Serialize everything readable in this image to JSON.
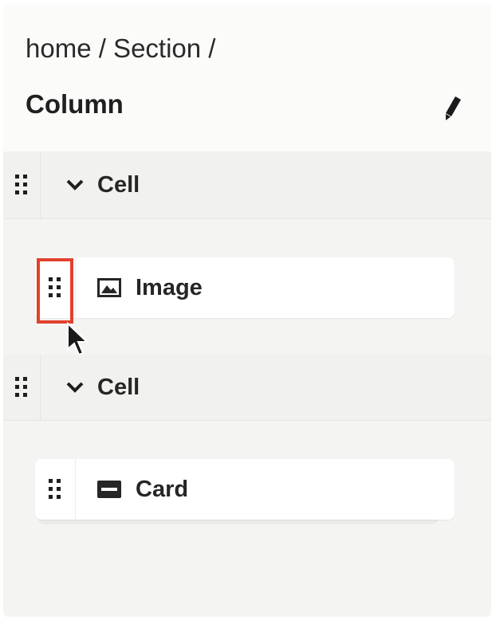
{
  "header": {
    "breadcrumb": "home / Section /",
    "title": "Column",
    "edit_icon": "pencil-icon"
  },
  "tree": {
    "cells": [
      {
        "label": "Cell",
        "expanded": true,
        "children": [
          {
            "label": "Image",
            "icon": "image-icon"
          }
        ]
      },
      {
        "label": "Cell",
        "expanded": true,
        "children": [
          {
            "label": "Card",
            "icon": "card-icon"
          }
        ]
      }
    ]
  },
  "annotation": {
    "highlight_color": "#e1412d"
  }
}
